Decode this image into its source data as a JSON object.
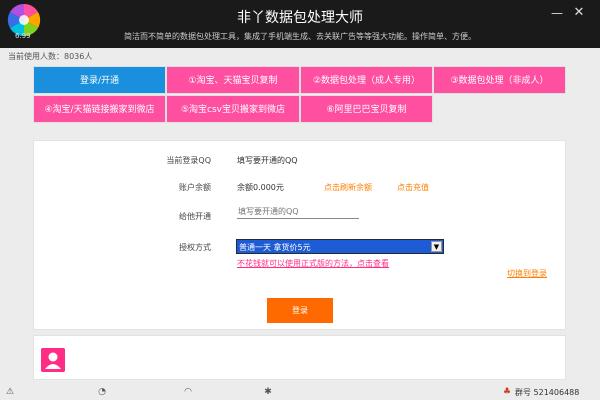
{
  "window": {
    "title": "非丫数据包处理大师",
    "version": "6.99",
    "subtitle": "简洁而不简单的数据包处理工具，集成了手机端生成、去关联广告等等强大功能。操作简单、方便。"
  },
  "user_count": "当前使用人数：8036人",
  "tabs": [
    {
      "label": "登录/开通",
      "active": true
    },
    {
      "label": "①淘宝、天猫宝贝复制",
      "active": false
    },
    {
      "label": "②数据包处理（成人专用）",
      "active": false
    },
    {
      "label": "③数据包处理（非成人）",
      "active": false
    },
    {
      "label": "④淘宝/天猫链接搬家到微店",
      "active": false
    },
    {
      "label": "⑤淘宝csv宝贝搬家到微店",
      "active": false
    },
    {
      "label": "⑥阿里巴巴宝贝复制",
      "active": false
    }
  ],
  "form": {
    "current_login_label": "当前登录QQ",
    "current_login_value": "填写要开通的QQ",
    "balance_label": "账户余额",
    "balance_value": "余额0.000元",
    "refresh_label": "点击刷新余额",
    "recharge_label": "点击充值",
    "open_for_label": "给他开通",
    "open_for_placeholder": "填写要开通的QQ",
    "auth_label": "授权方式",
    "auth_selected": "普通一天  拿货价5元",
    "hint": "不花钱就可以使用正式版的方法，点击查看",
    "switch_login": "切换到登录",
    "login_button": "登录"
  },
  "statusbar": {
    "qq_group": "群号  521406488"
  },
  "colors": {
    "accent_pink": "#ff4fa1",
    "accent_blue": "#1a8fdd",
    "orange": "#ff7e00",
    "titlebar": "#1a1a1a"
  }
}
